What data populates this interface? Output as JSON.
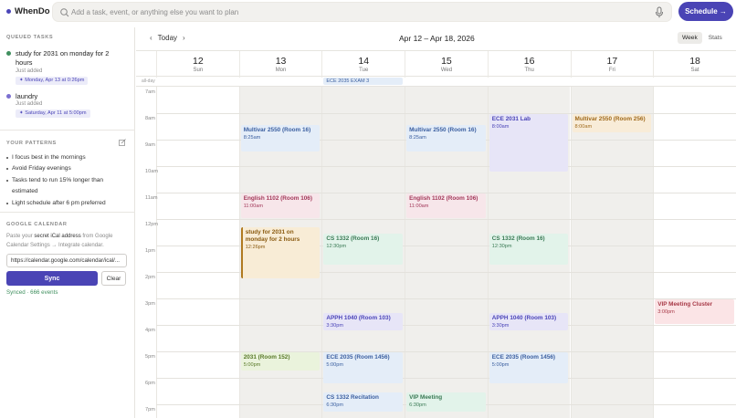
{
  "app": {
    "name": "WhenDo"
  },
  "search": {
    "placeholder": "Add a task, event, or anything else you want to plan"
  },
  "schedule_button": "Schedule →",
  "sidebar": {
    "queued_title": "QUEUED TASKS",
    "tasks": [
      {
        "name": "study for 2031 on monday for 2 hours",
        "sub": "Just added",
        "badge": "✦ Monday, Apr 13 at 0:26pm",
        "dot_color": "#3f8f5e"
      },
      {
        "name": "laundry",
        "sub": "Just added",
        "badge": "✦ Saturday, Apr 11 at 5:00pm",
        "dot_color": "#7b6fd0"
      }
    ],
    "patterns_title": "YOUR PATTERNS",
    "patterns": [
      "I focus best in the mornings",
      "Avoid Friday evenings",
      "Tasks tend to run 15% longer than estimated",
      "Light schedule after 6 pm preferred"
    ],
    "gcal_title": "GOOGLE CALENDAR",
    "gcal_desc_1": "Paste your ",
    "gcal_desc_bold": "secret iCal address",
    "gcal_desc_2": " from Google Calendar Settings → Integrate calendar.",
    "gcal_url": "https://calendar.google.com/calendar/ical/...",
    "sync_label": "Sync",
    "clear_label": "Clear",
    "synced_status": "Synced · 666 events"
  },
  "calendar": {
    "today_label": "Today",
    "prev": "‹",
    "next": "›",
    "range": "Apr 12 – Apr 18, 2026",
    "views": [
      "Week",
      "Stats"
    ],
    "active_view": "Week",
    "allday_label": "all-day",
    "days": [
      {
        "num": "12",
        "name": "Sun"
      },
      {
        "num": "13",
        "name": "Mon"
      },
      {
        "num": "14",
        "name": "Tue"
      },
      {
        "num": "15",
        "name": "Wed"
      },
      {
        "num": "16",
        "name": "Thu"
      },
      {
        "num": "17",
        "name": "Fri"
      },
      {
        "num": "18",
        "name": "Sat"
      }
    ],
    "hours": [
      "7am",
      "8am",
      "9am",
      "10am",
      "11am",
      "12pm",
      "1pm",
      "2pm",
      "3pm",
      "4pm",
      "5pm",
      "6pm",
      "7pm"
    ],
    "allday_events": [
      {
        "day": 2,
        "title": "ECE 2035 EXAM 3"
      }
    ],
    "events": [
      {
        "day": 1,
        "title": "Multivar 2550 (Room 16)",
        "time": "8:25am",
        "start": 8.42,
        "end": 9.5,
        "color": "#e4edf8",
        "text": "#3b5fa0"
      },
      {
        "day": 3,
        "title": "Multivar 2550 (Room 16)",
        "time": "8:25am",
        "start": 8.42,
        "end": 9.5,
        "color": "#e4edf8",
        "text": "#3b5fa0"
      },
      {
        "day": 4,
        "title": "ECE 2031 Lab",
        "time": "8:00am",
        "start": 8.0,
        "end": 10.25,
        "color": "#e7e5f7",
        "text": "#4b45b8"
      },
      {
        "day": 5,
        "title": "Multivar 2550 (Room 256)",
        "time": "8:00am",
        "start": 8.0,
        "end": 8.75,
        "color": "#f8ecd8",
        "text": "#a06a1c"
      },
      {
        "day": 1,
        "title": "English 1102 (Room 106)",
        "time": "11:00am",
        "start": 11.0,
        "end": 12.0,
        "color": "#f7e6ea",
        "text": "#a3395a"
      },
      {
        "day": 3,
        "title": "English 1102 (Room 106)",
        "time": "11:00am",
        "start": 11.0,
        "end": 12.0,
        "color": "#f7e6ea",
        "text": "#a3395a"
      },
      {
        "day": 1,
        "title": "study for 2031 on monday for 2 hours",
        "time": "12:26pm",
        "start": 12.26,
        "end": 14.26,
        "color": "#f8ecd6",
        "text": "#8a5a10",
        "border": "#b07a20"
      },
      {
        "day": 2,
        "title": "CS 1332 (Room 16)",
        "time": "12:30pm",
        "start": 12.5,
        "end": 13.75,
        "color": "#e2f3ea",
        "text": "#3a7a55"
      },
      {
        "day": 4,
        "title": "CS 1332 (Room 16)",
        "time": "12:30pm",
        "start": 12.5,
        "end": 13.75,
        "color": "#e2f3ea",
        "text": "#3a7a55"
      },
      {
        "day": 6,
        "title": "VIP Meeting Cluster",
        "time": "3:00pm",
        "start": 15.0,
        "end": 16.0,
        "color": "#fbe4e6",
        "text": "#a83a48"
      },
      {
        "day": 2,
        "title": "APPH 1040 (Room 103)",
        "time": "3:30pm",
        "start": 15.5,
        "end": 16.25,
        "color": "#e7e5f7",
        "text": "#4b45b8"
      },
      {
        "day": 4,
        "title": "APPH 1040 (Room 103)",
        "time": "3:30pm",
        "start": 15.5,
        "end": 16.25,
        "color": "#e7e5f7",
        "text": "#4b45b8"
      },
      {
        "day": 1,
        "title": "2031 (Room 152)",
        "time": "5:00pm",
        "start": 17.0,
        "end": 17.75,
        "color": "#eaf3dc",
        "text": "#5a7a2a"
      },
      {
        "day": 2,
        "title": "ECE 2035 (Room 1456)",
        "time": "5:00pm",
        "start": 17.0,
        "end": 18.25,
        "color": "#e4edf8",
        "text": "#3b5fa0"
      },
      {
        "day": 4,
        "title": "ECE 2035 (Room 1456)",
        "time": "5:00pm",
        "start": 17.0,
        "end": 18.25,
        "color": "#e4edf8",
        "text": "#3b5fa0"
      },
      {
        "day": 2,
        "title": "CS 1332 Recitation",
        "time": "6:30pm",
        "start": 18.5,
        "end": 19.3,
        "color": "#e4edf8",
        "text": "#3b5fa0"
      },
      {
        "day": 3,
        "title": "VIP Meeting",
        "time": "6:30pm",
        "start": 18.5,
        "end": 19.3,
        "color": "#e2f3ea",
        "text": "#3a7a55"
      }
    ]
  }
}
